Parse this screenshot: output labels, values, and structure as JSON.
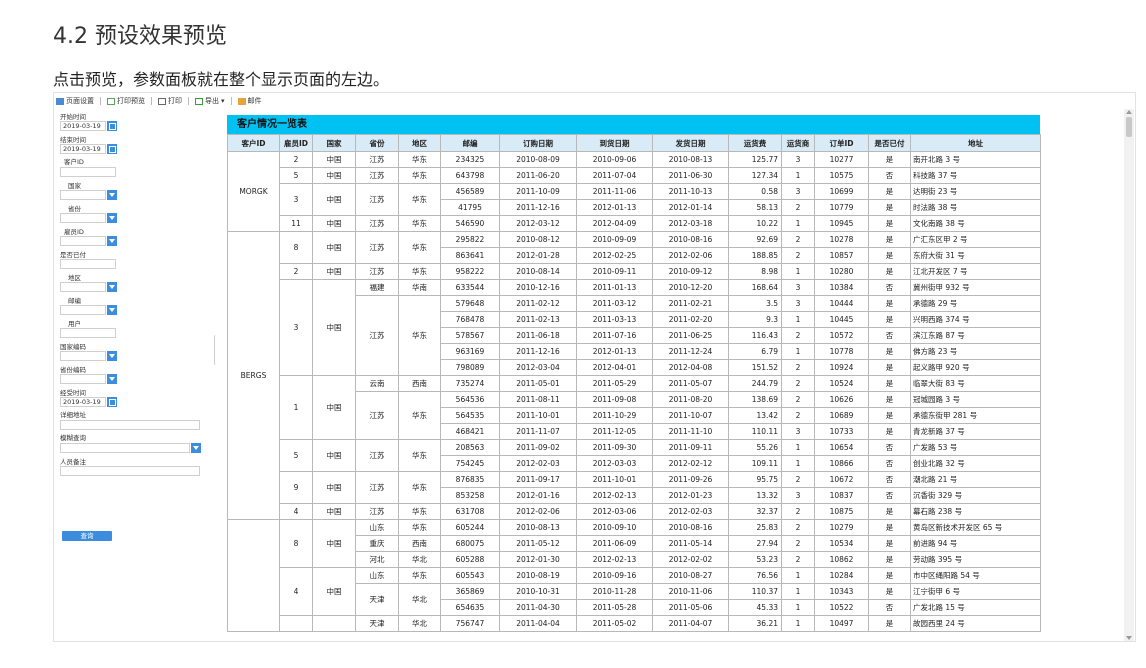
{
  "doc": {
    "heading": "4.2 预设效果预览",
    "paragraph": "点击预览，参数面板就在整个显示页面的左边。"
  },
  "toolbar": {
    "page_setup": "页面设置",
    "print_preview": "打印预览",
    "print": "打印",
    "export": "导出",
    "mail": "邮件"
  },
  "params": {
    "start_time_label": "开始时间",
    "start_time_value": "2019-03-19",
    "end_time_label": "结束时间",
    "end_time_value": "2019-03-19",
    "customer_id_label": "客户ID",
    "country_label": "国家",
    "province_label": "省份",
    "employee_id_label": "雇员ID",
    "paid_label": "是否已付",
    "region_label": "地区",
    "postcode_label": "邮编",
    "user_label": "用户",
    "country_code_label": "国家编码",
    "province_code_label": "省份编码",
    "handle_time_label": "经受时间",
    "handle_time_value": "2019-03-19",
    "detail_addr_label": "详细地址",
    "fuzzy_query_label": "模糊查询",
    "staff_note_label": "人员备注",
    "query_button": "查询"
  },
  "report": {
    "title": "客户情况一览表",
    "headers": [
      "客户ID",
      "雇员ID",
      "国家",
      "省份",
      "地区",
      "邮编",
      "订购日期",
      "到货日期",
      "发货日期",
      "运货费",
      "运货商",
      "订单ID",
      "是否已付",
      "地址"
    ]
  },
  "groups": [
    {
      "customer": "MORGK",
      "employees": [
        {
          "id": "2",
          "country": "中国",
          "provs": [
            {
              "p": "江苏",
              "r": "华东",
              "rows": [
                [
                  "234325",
                  "2010-08-09",
                  "2010-09-06",
                  "2010-08-13",
                  "125.77",
                  "3",
                  "10277",
                  "是",
                  "南开北路 3 号"
                ]
              ]
            }
          ]
        },
        {
          "id": "5",
          "country": "中国",
          "provs": [
            {
              "p": "江苏",
              "r": "华东",
              "rows": [
                [
                  "643798",
                  "2011-06-20",
                  "2011-07-04",
                  "2011-06-30",
                  "127.34",
                  "1",
                  "10575",
                  "否",
                  "科技路 37 号"
                ]
              ]
            }
          ]
        },
        {
          "id": "3",
          "country": "中国",
          "provs": [
            {
              "p": "江苏",
              "r": "华东",
              "rows": [
                [
                  "456589",
                  "2011-10-09",
                  "2011-11-06",
                  "2011-10-13",
                  "0.58",
                  "3",
                  "10699",
                  "是",
                  "达明街 23 号"
                ],
                [
                  "41795",
                  "2011-12-16",
                  "2012-01-13",
                  "2012-01-14",
                  "58.13",
                  "2",
                  "10779",
                  "是",
                  "时法路 38 号"
                ]
              ]
            }
          ]
        },
        {
          "id": "11",
          "country": "中国",
          "provs": [
            {
              "p": "江苏",
              "r": "华东",
              "rows": [
                [
                  "546590",
                  "2012-03-12",
                  "2012-04-09",
                  "2012-03-18",
                  "10.22",
                  "1",
                  "10945",
                  "是",
                  "文化南路 38 号"
                ]
              ]
            }
          ]
        }
      ]
    },
    {
      "customer": "BERGS",
      "employees": [
        {
          "id": "8",
          "country": "中国",
          "provs": [
            {
              "p": "江苏",
              "r": "华东",
              "rows": [
                [
                  "295822",
                  "2010-08-12",
                  "2010-09-09",
                  "2010-08-16",
                  "92.69",
                  "2",
                  "10278",
                  "是",
                  "广汇东区甲 2 号"
                ],
                [
                  "863641",
                  "2012-01-28",
                  "2012-02-25",
                  "2012-02-06",
                  "188.85",
                  "2",
                  "10857",
                  "是",
                  "东府大街 31 号"
                ]
              ]
            }
          ]
        },
        {
          "id": "2",
          "country": "中国",
          "provs": [
            {
              "p": "江苏",
              "r": "华东",
              "rows": [
                [
                  "958222",
                  "2010-08-14",
                  "2010-09-11",
                  "2010-09-12",
                  "8.98",
                  "1",
                  "10280",
                  "是",
                  "江北开发区 7 号"
                ]
              ]
            }
          ]
        },
        {
          "id": "3",
          "country": "中国",
          "provs": [
            {
              "p": "福建",
              "r": "华南",
              "rows": [
                [
                  "633544",
                  "2010-12-16",
                  "2011-01-13",
                  "2010-12-20",
                  "168.64",
                  "3",
                  "10384",
                  "否",
                  "冀州街甲 932 号"
                ]
              ]
            },
            {
              "p": "江苏",
              "r": "华东",
              "rows": [
                [
                  "579648",
                  "2011-02-12",
                  "2011-03-12",
                  "2011-02-21",
                  "3.5",
                  "3",
                  "10444",
                  "是",
                  "承德路 29 号"
                ],
                [
                  "768478",
                  "2011-02-13",
                  "2011-03-13",
                  "2011-02-20",
                  "9.3",
                  "1",
                  "10445",
                  "是",
                  "兴明西路 374 号"
                ],
                [
                  "578567",
                  "2011-06-18",
                  "2011-07-16",
                  "2011-06-25",
                  "116.43",
                  "2",
                  "10572",
                  "否",
                  "滨江东路 87 号"
                ],
                [
                  "963169",
                  "2011-12-16",
                  "2012-01-13",
                  "2011-12-24",
                  "6.79",
                  "1",
                  "10778",
                  "是",
                  "佛方路 23 号"
                ],
                [
                  "798089",
                  "2012-03-04",
                  "2012-04-01",
                  "2012-04-08",
                  "151.52",
                  "2",
                  "10924",
                  "是",
                  "起义路甲 920 号"
                ]
              ]
            }
          ]
        },
        {
          "id": "1",
          "country": "中国",
          "provs": [
            {
              "p": "云南",
              "r": "西南",
              "rows": [
                [
                  "735274",
                  "2011-05-01",
                  "2011-05-29",
                  "2011-05-07",
                  "244.79",
                  "2",
                  "10524",
                  "是",
                  "临翠大街 83 号"
                ]
              ]
            },
            {
              "p": "江苏",
              "r": "华东",
              "rows": [
                [
                  "564536",
                  "2011-08-11",
                  "2011-09-08",
                  "2011-08-20",
                  "138.69",
                  "2",
                  "10626",
                  "是",
                  "冠城园路 3 号"
                ],
                [
                  "564535",
                  "2011-10-01",
                  "2011-10-29",
                  "2011-10-07",
                  "13.42",
                  "2",
                  "10689",
                  "是",
                  "承德东街甲 281 号"
                ],
                [
                  "468421",
                  "2011-11-07",
                  "2011-12-05",
                  "2011-11-10",
                  "110.11",
                  "3",
                  "10733",
                  "是",
                  "青龙新路 37 号"
                ]
              ]
            }
          ]
        },
        {
          "id": "5",
          "country": "中国",
          "provs": [
            {
              "p": "江苏",
              "r": "华东",
              "rows": [
                [
                  "208563",
                  "2011-09-02",
                  "2011-09-30",
                  "2011-09-11",
                  "55.26",
                  "1",
                  "10654",
                  "否",
                  "广发路 53 号"
                ],
                [
                  "754245",
                  "2012-02-03",
                  "2012-03-03",
                  "2012-02-12",
                  "109.11",
                  "1",
                  "10866",
                  "否",
                  "创业北路 32 号"
                ]
              ]
            }
          ]
        },
        {
          "id": "9",
          "country": "中国",
          "provs": [
            {
              "p": "江苏",
              "r": "华东",
              "rows": [
                [
                  "876835",
                  "2011-09-17",
                  "2011-10-01",
                  "2011-09-26",
                  "95.75",
                  "2",
                  "10672",
                  "否",
                  "潮北路 21 号"
                ],
                [
                  "853258",
                  "2012-01-16",
                  "2012-02-13",
                  "2012-01-23",
                  "13.32",
                  "3",
                  "10837",
                  "否",
                  "沉香街 329 号"
                ]
              ]
            }
          ]
        },
        {
          "id": "4",
          "country": "中国",
          "provs": [
            {
              "p": "江苏",
              "r": "华东",
              "rows": [
                [
                  "631708",
                  "2012-02-06",
                  "2012-03-06",
                  "2012-02-03",
                  "32.37",
                  "2",
                  "10875",
                  "是",
                  "幕石路 238 号"
                ]
              ]
            }
          ]
        }
      ]
    },
    {
      "customer": "",
      "employees": [
        {
          "id": "8",
          "country": "中国",
          "provs": [
            {
              "p": "山东",
              "r": "华东",
              "rows": [
                [
                  "605244",
                  "2010-08-13",
                  "2010-09-10",
                  "2010-08-16",
                  "25.83",
                  "2",
                  "10279",
                  "是",
                  "黄岛区新技术开发区 65 号"
                ]
              ]
            },
            {
              "p": "重庆",
              "r": "西南",
              "rows": [
                [
                  "680075",
                  "2011-05-12",
                  "2011-06-09",
                  "2011-05-14",
                  "27.94",
                  "2",
                  "10534",
                  "是",
                  "前进路 94 号"
                ]
              ]
            },
            {
              "p": "河北",
              "r": "华北",
              "rows": [
                [
                  "605288",
                  "2012-01-30",
                  "2012-02-13",
                  "2012-02-02",
                  "53.23",
                  "2",
                  "10862",
                  "是",
                  "劳动路 395 号"
                ]
              ]
            }
          ]
        },
        {
          "id": "4",
          "country": "中国",
          "provs": [
            {
              "p": "山东",
              "r": "华东",
              "rows": [
                [
                  "605543",
                  "2010-08-19",
                  "2010-09-16",
                  "2010-08-27",
                  "76.56",
                  "1",
                  "10284",
                  "是",
                  "市中区绳阳路 54 号"
                ]
              ]
            },
            {
              "p": "天津",
              "r": "华北",
              "rows": [
                [
                  "365869",
                  "2010-10-31",
                  "2010-11-28",
                  "2010-11-06",
                  "110.37",
                  "1",
                  "10343",
                  "是",
                  "江宁街甲 6 号"
                ],
                [
                  "654635",
                  "2011-04-30",
                  "2011-05-28",
                  "2011-05-06",
                  "45.33",
                  "1",
                  "10522",
                  "否",
                  "广发北路 15 号"
                ]
              ]
            }
          ]
        },
        {
          "id": "",
          "country": "",
          "provs": [
            {
              "p": "天津",
              "r": "华北",
              "rows": [
                [
                  "756747",
                  "2011-04-04",
                  "2011-05-02",
                  "2011-04-07",
                  "36.21",
                  "1",
                  "10497",
                  "是",
                  "故园西里 24 号"
                ]
              ]
            }
          ]
        }
      ]
    }
  ]
}
